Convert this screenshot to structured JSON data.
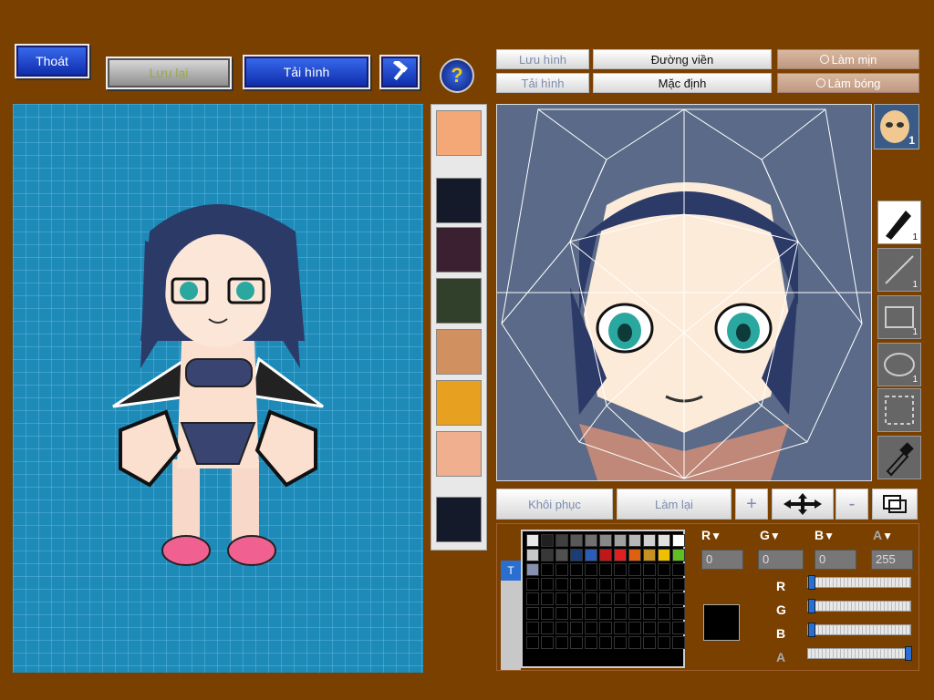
{
  "toolbar": {
    "exit_label": "Thoát",
    "save_label": "Lưu lại",
    "load_label": "Tải hình",
    "help_label": "?"
  },
  "editor_top": {
    "save_image_label": "Lưu hình",
    "load_image_label": "Tải hình",
    "outline_label": "Đường viền",
    "default_label": "Mặc định",
    "smooth_label": "Làm mịn",
    "shade_label": "Làm bóng"
  },
  "face_badge": "1",
  "tools": [
    {
      "name": "pen",
      "count": "1"
    },
    {
      "name": "line",
      "count": "1"
    },
    {
      "name": "rectangle",
      "count": "1"
    },
    {
      "name": "ellipse",
      "count": "1"
    },
    {
      "name": "selection",
      "count": ""
    },
    {
      "name": "eyedropper",
      "count": ""
    }
  ],
  "actions": {
    "restore_label": "Khôi phục",
    "redo_label": "Làm lại",
    "plus_label": "+",
    "minus_label": "-"
  },
  "color": {
    "r_value": "0",
    "g_value": "0",
    "b_value": "0",
    "a_value": "255",
    "r": 0,
    "g": 0,
    "b": 0,
    "a": 255,
    "current": "#000000",
    "swatches": [
      "#e8e8e8",
      "#202020",
      "#404040",
      "#585858",
      "#707070",
      "#888888",
      "#a0a0a0",
      "#b8b8b8",
      "#d0d0d0",
      "#e0e0e0",
      "#ffffff",
      "#c8c8c8",
      "#383838",
      "#505050",
      "#1c3c78",
      "#2a5cb8",
      "#c01818",
      "#e02020",
      "#e06010",
      "#c89020",
      "#f0c000",
      "#60c020",
      "#8890b0"
    ],
    "palette_tab": "T"
  },
  "colors": {
    "background": "#7a4000",
    "canvas_bg": "#5a6a88",
    "grid_bg": "#1e8ab8"
  }
}
